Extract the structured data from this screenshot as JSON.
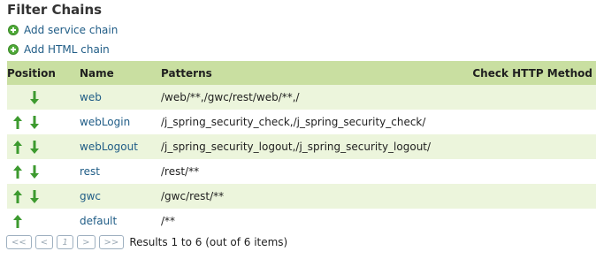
{
  "title": "Filter Chains",
  "actions": {
    "add_service_chain": "Add service chain",
    "add_html_chain": "Add HTML chain"
  },
  "table": {
    "headers": {
      "position": "Position",
      "name": "Name",
      "patterns": "Patterns",
      "check_http_method": "Check HTTP Method"
    },
    "rows": [
      {
        "name": "web",
        "patterns": "/web/**,/gwc/rest/web/**,/",
        "up": false,
        "down": true
      },
      {
        "name": "webLogin",
        "patterns": "/j_spring_security_check,/j_spring_security_check/",
        "up": true,
        "down": true
      },
      {
        "name": "webLogout",
        "patterns": "/j_spring_security_logout,/j_spring_security_logout/",
        "up": true,
        "down": true
      },
      {
        "name": "rest",
        "patterns": "/rest/**",
        "up": true,
        "down": true
      },
      {
        "name": "gwc",
        "patterns": "/gwc/rest/**",
        "up": true,
        "down": true
      },
      {
        "name": "default",
        "patterns": "/**",
        "up": true,
        "down": false
      }
    ]
  },
  "pager": {
    "first": "<<",
    "prev": "<",
    "page": "1",
    "next": ">",
    "last": ">>",
    "results": "Results 1 to 6 (out of 6 items)"
  },
  "colors": {
    "header_bg": "#c9dfa1",
    "odd_row_bg": "#ecf5dc",
    "link": "#1f5c86",
    "arrow": "#3d9a2f"
  }
}
